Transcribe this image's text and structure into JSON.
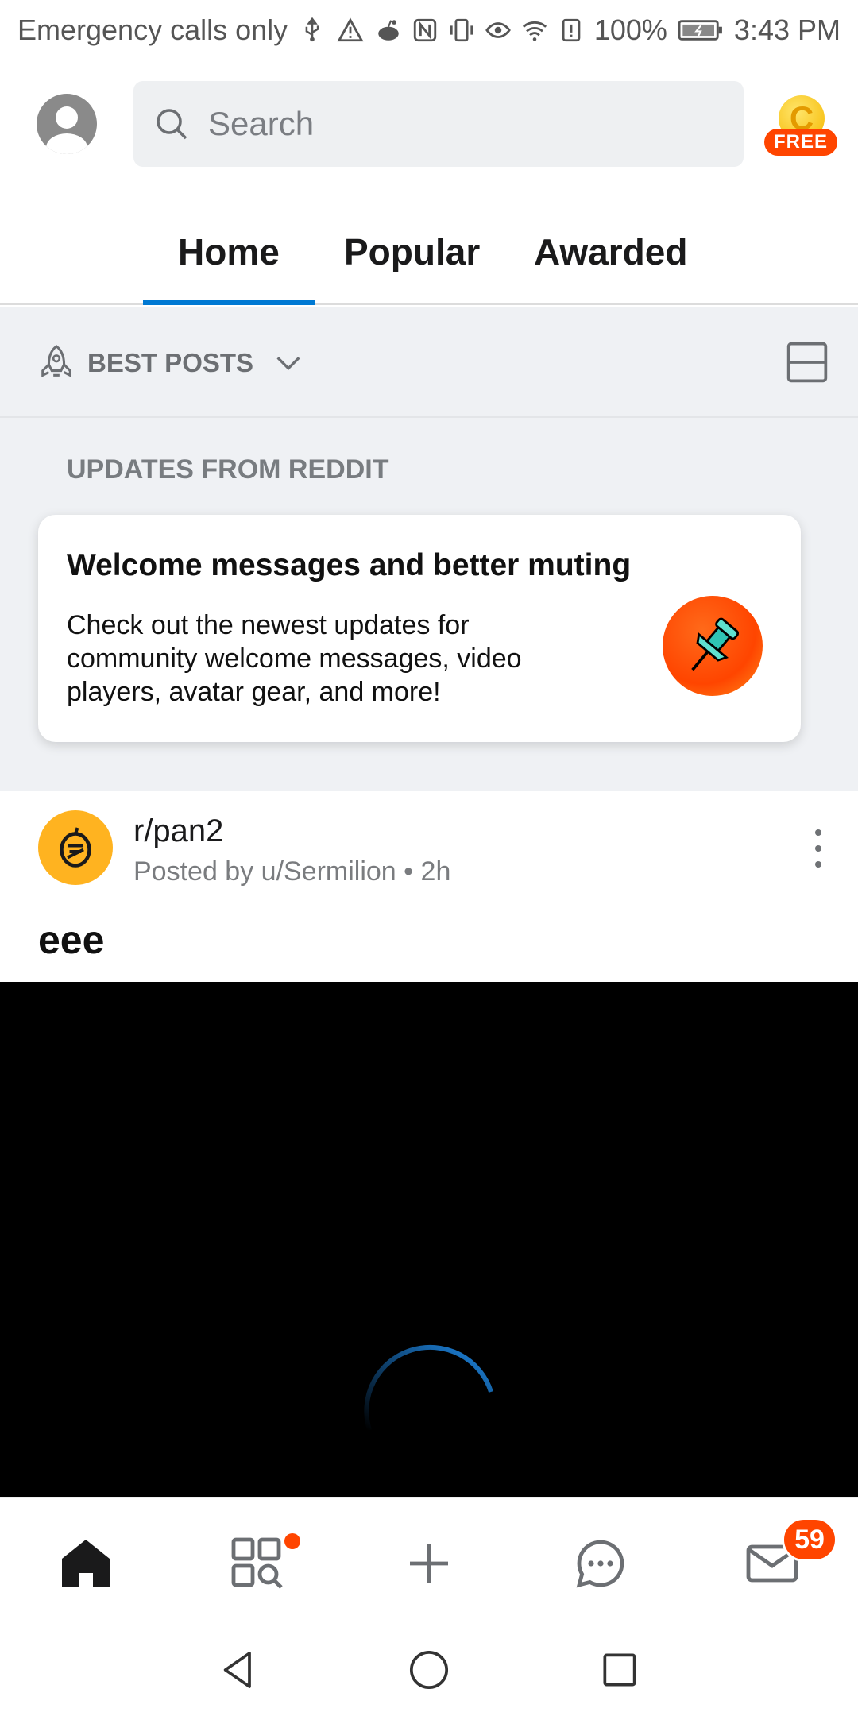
{
  "status_bar": {
    "carrier_text": "Emergency calls only",
    "battery": "100%",
    "time": "3:43 PM"
  },
  "header": {
    "search_placeholder": "Search",
    "coin_letter": "C",
    "coin_badge": "FREE"
  },
  "tabs": [
    {
      "label": "Home",
      "active": true
    },
    {
      "label": "Popular",
      "active": false
    },
    {
      "label": "Awarded",
      "active": false
    }
  ],
  "sort": {
    "label": "BEST POSTS"
  },
  "updates": {
    "section_title": "UPDATES FROM REDDIT",
    "card_title": "Welcome messages and better muting",
    "card_body": "Check out the newest updates for community welcome messages, video players, avatar gear, and more!"
  },
  "post": {
    "subreddit": "r/pan2",
    "posted_by": "Posted by u/Sermilion",
    "separator": " • ",
    "age": "2h",
    "title": "eee"
  },
  "bottom_nav": {
    "inbox_badge": "59"
  },
  "colors": {
    "accent": "#0079d3",
    "brand": "#ff4500",
    "subreddit_avatar": "#ffb320"
  }
}
